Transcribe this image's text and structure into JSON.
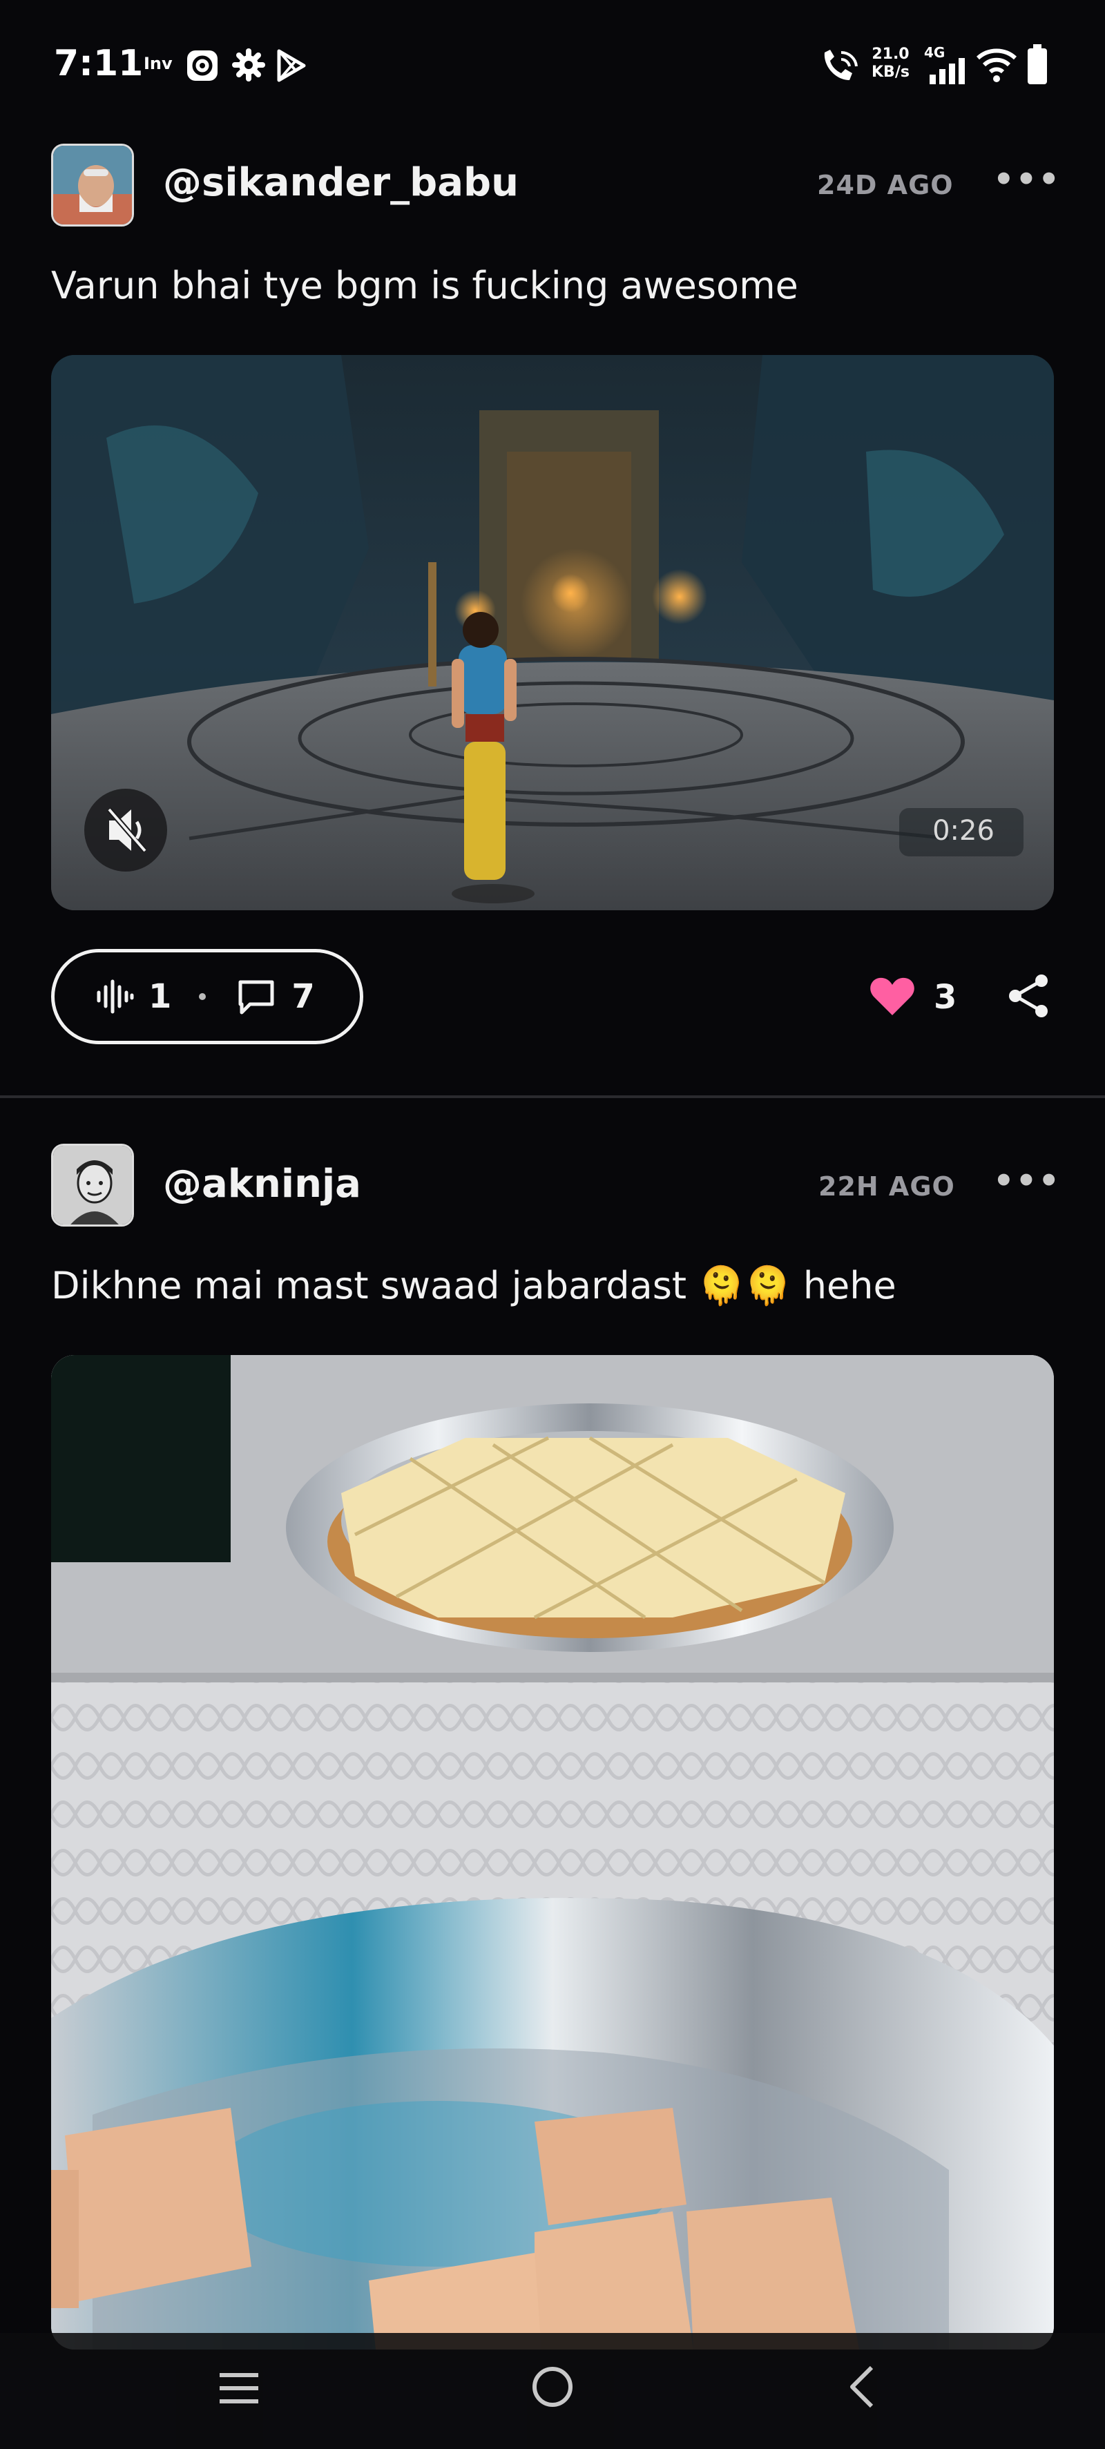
{
  "status_bar": {
    "time": "7:11",
    "inv_label": "Inv",
    "net_speed_value": "21.0",
    "net_speed_unit": "KB/s",
    "network_type": "4G",
    "icons": [
      "radio-icon",
      "gear-icon",
      "play-store-icon",
      "call-wifi-icon",
      "signal-icon",
      "wifi-icon",
      "battery-icon"
    ]
  },
  "posts": [
    {
      "username": "@sikander_babu",
      "age": "24D AGO",
      "more": "•••",
      "text": "Varun bhai tye bgm is fucking awesome",
      "media": {
        "type": "video",
        "duration": "0:26",
        "muted": true
      },
      "voice_count": "1",
      "comment_count": "7",
      "like_count": "3",
      "liked": true
    },
    {
      "username": "@akninja",
      "age": "22H AGO",
      "more": "•••",
      "text": "Dikhne mai mast swaad jabardast 🫠🫠 hehe",
      "media": {
        "type": "image"
      }
    }
  ],
  "colors": {
    "background": "#07070a",
    "like": "#ff5fa2",
    "muted_text": "#9a9aa0"
  },
  "nav_bar": {
    "icons": [
      "menu-icon",
      "home-circle-icon",
      "back-chevron-icon"
    ]
  }
}
